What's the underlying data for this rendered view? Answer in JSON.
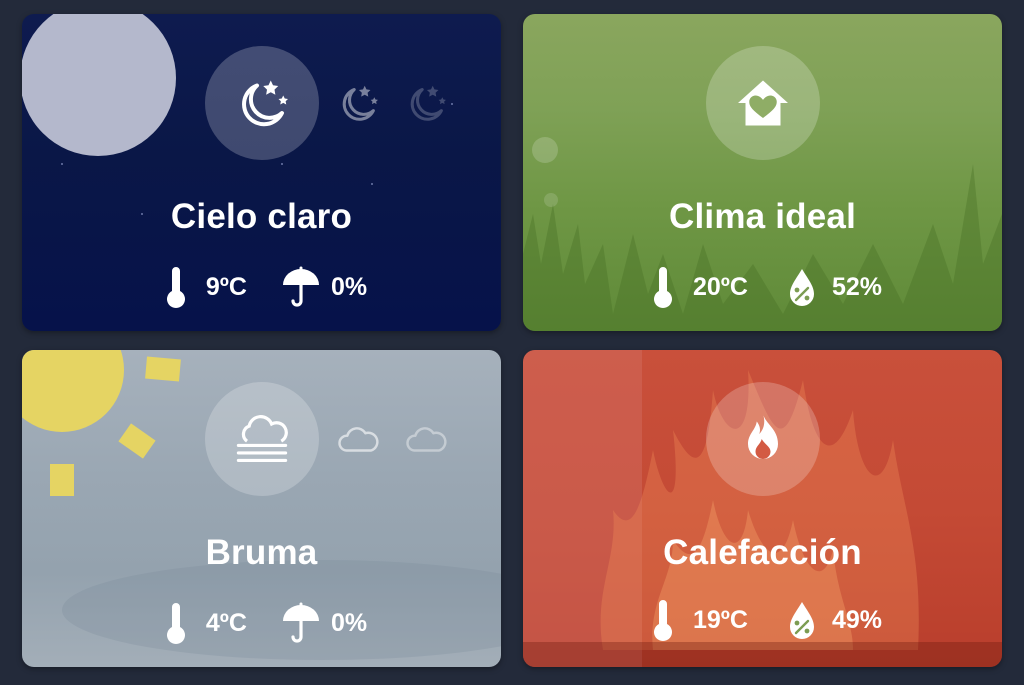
{
  "cards": [
    {
      "title": "Cielo claro",
      "condition_icon": "moon-stars-icon",
      "forecast_icons": [
        "moon-stars-icon",
        "moon-stars-icon"
      ],
      "stats": [
        {
          "icon": "thermometer-icon",
          "value": "9ºC"
        },
        {
          "icon": "umbrella-icon",
          "value": "0%"
        }
      ]
    },
    {
      "title": "Clima ideal",
      "condition_icon": "home-heart-icon",
      "stats": [
        {
          "icon": "thermometer-icon",
          "value": "20ºC"
        },
        {
          "icon": "humidity-icon",
          "value": "52%"
        }
      ]
    },
    {
      "title": "Bruma",
      "condition_icon": "fog-icon",
      "forecast_icons": [
        "cloud-icon",
        "cloud-icon"
      ],
      "stats": [
        {
          "icon": "thermometer-icon",
          "value": "4ºC"
        },
        {
          "icon": "umbrella-icon",
          "value": "0%"
        }
      ]
    },
    {
      "title": "Calefacción",
      "condition_icon": "fire-icon",
      "stats": [
        {
          "icon": "thermometer-icon",
          "value": "19ºC"
        },
        {
          "icon": "humidity-icon",
          "value": "49%"
        }
      ]
    }
  ],
  "colors": {
    "page_bg": "#232a3a",
    "night": "#0a1747",
    "grass": "#7fa156",
    "mist": "#9aa7b3",
    "fire": "#c44a35",
    "sun": "#e5d463",
    "moon": "#b4b8cc"
  }
}
